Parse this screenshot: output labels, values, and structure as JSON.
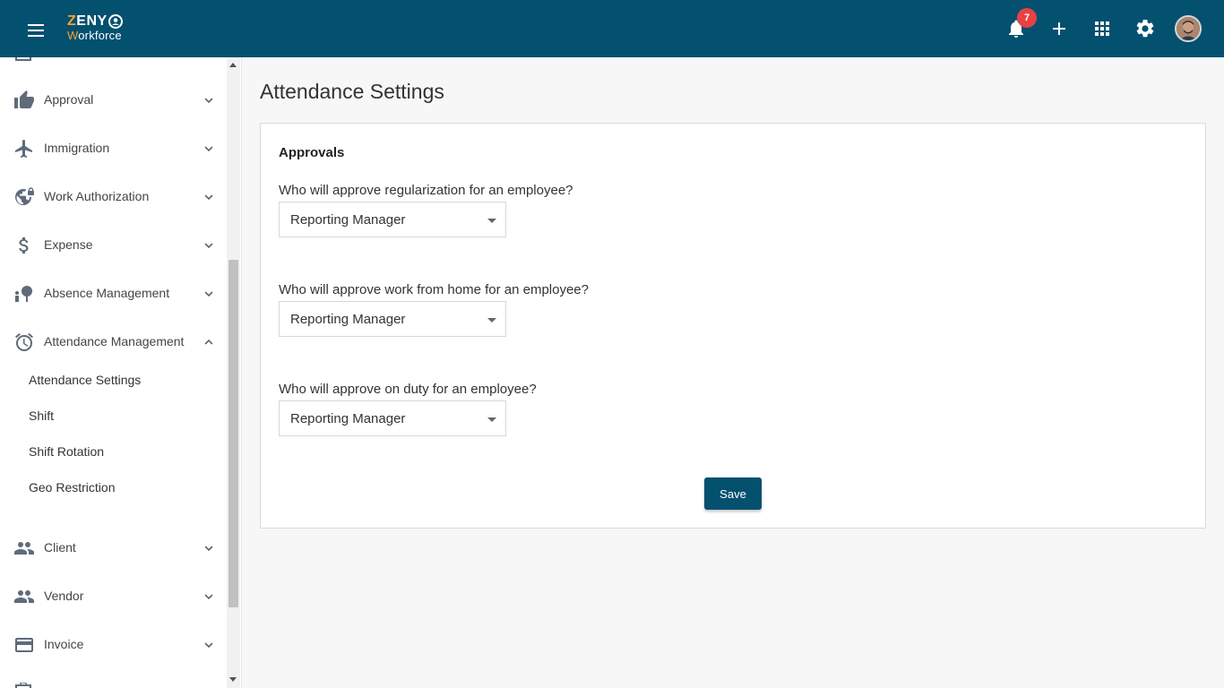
{
  "header": {
    "logo": {
      "line1_accent": "Z",
      "line1_rest": "ENY",
      "line2_accent": "W",
      "line2_rest": "orkforce"
    },
    "notification_count": "7",
    "icons": [
      "menu-icon",
      "bell-icon",
      "plus-icon",
      "apps-grid-icon",
      "gear-icon",
      "avatar"
    ]
  },
  "sidebar": {
    "items": [
      {
        "label": "Approval",
        "icon": "thumbs-up-icon",
        "expanded": false
      },
      {
        "label": "Immigration",
        "icon": "airplane-icon",
        "expanded": false
      },
      {
        "label": "Work Authorization",
        "icon": "globe-lock-icon",
        "expanded": false
      },
      {
        "label": "Expense",
        "icon": "dollar-icon",
        "expanded": false
      },
      {
        "label": "Absence Management",
        "icon": "person-tree-icon",
        "expanded": false
      },
      {
        "label": "Attendance Management",
        "icon": "alarm-clock-icon",
        "expanded": true
      },
      {
        "label": "Client",
        "icon": "people-icon",
        "expanded": false
      },
      {
        "label": "Vendor",
        "icon": "people-icon",
        "expanded": false
      },
      {
        "label": "Invoice",
        "icon": "credit-card-icon",
        "expanded": false
      }
    ],
    "attendance_sub_items": [
      "Attendance Settings",
      "Shift",
      "Shift Rotation",
      "Geo Restriction"
    ]
  },
  "main": {
    "page_title": "Attendance Settings",
    "section_title": "Approvals",
    "questions": [
      {
        "label": "Who will approve regularization for an employee?",
        "value": "Reporting Manager"
      },
      {
        "label": "Who will approve work from home for an employee?",
        "value": "Reporting Manager"
      },
      {
        "label": "Who will approve on duty for an employee?",
        "value": "Reporting Manager"
      }
    ],
    "save_label": "Save"
  },
  "colors": {
    "brand": "#04506f",
    "accent": "#f2a33a",
    "badge": "#e84142"
  }
}
